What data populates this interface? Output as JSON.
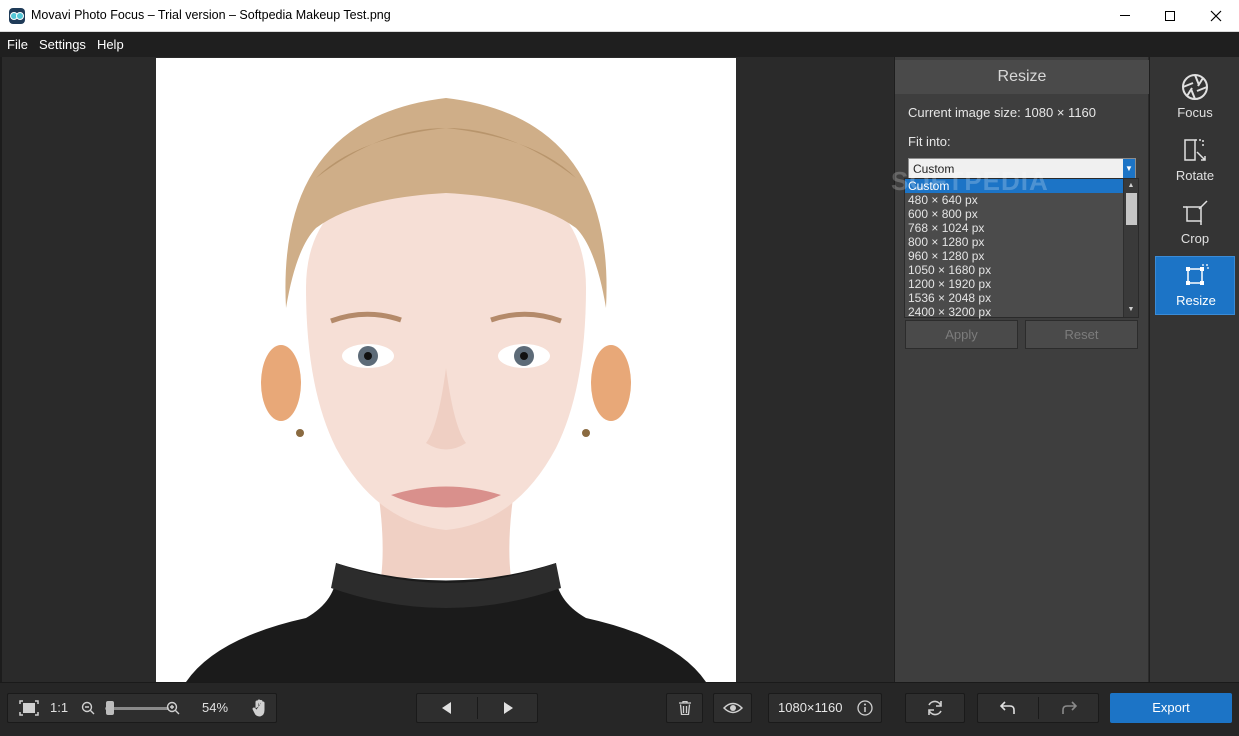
{
  "window": {
    "title": "Movavi Photo Focus – Trial version – Softpedia Makeup Test.png"
  },
  "menu": {
    "items": [
      "File",
      "Settings",
      "Help"
    ]
  },
  "panel": {
    "title": "Resize",
    "current_size_label": "Current image size: 1080 × 1160",
    "fit_into_label": "Fit into:",
    "selected_option": "Custom",
    "options": [
      "Custom",
      "480 × 640 px",
      "600 × 800 px",
      "768 × 1024 px",
      "800 × 1280 px",
      "960 × 1280 px",
      "1050 × 1680 px",
      "1200 × 1920 px",
      "1536 × 2048 px",
      "2400 × 3200 px"
    ],
    "apply_label": "Apply",
    "reset_label": "Reset",
    "watermark": "SOFTPEDIA"
  },
  "tools": {
    "items": [
      {
        "label": "Focus",
        "icon": "aperture-icon"
      },
      {
        "label": "Rotate",
        "icon": "rotate-icon"
      },
      {
        "label": "Crop",
        "icon": "crop-icon"
      },
      {
        "label": "Resize",
        "icon": "resize-icon"
      }
    ],
    "active": "Resize"
  },
  "bottom": {
    "one_to_one": "1:1",
    "zoom_percent": "54%",
    "zoom_level": 0.05,
    "image_size": "1080×1160",
    "export_label": "Export"
  },
  "colors": {
    "accent": "#1c74c6",
    "panel_bg": "#3e3e3e",
    "workspace_bg": "#2a2a2a"
  }
}
